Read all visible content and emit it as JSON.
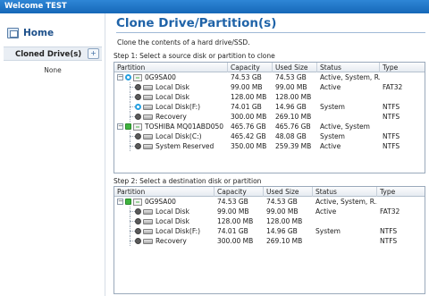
{
  "window": {
    "title": "Welcome TEST"
  },
  "sidebar": {
    "home_label": "Home",
    "cloned_label": "Cloned Drive(s)",
    "add_label": "+",
    "empty_text": "None"
  },
  "page": {
    "title": "Clone Drive/Partition(s)",
    "description": "Clone the contents of a hard drive/SSD."
  },
  "columns": [
    "Partition",
    "Capacity",
    "Used Size",
    "Status",
    "Type"
  ],
  "step1": {
    "title": "Step 1: Select a source disk or partition to clone",
    "rows": [
      {
        "kind": "disk",
        "expander": "−",
        "radio": "selected",
        "name": "0G9SA00",
        "capacity": "74.53 GB",
        "used": "74.53 GB",
        "status": "Active, System, R...",
        "type": ""
      },
      {
        "kind": "part",
        "radio": "gray",
        "name": "Local Disk",
        "capacity": "99.00 MB",
        "used": "99.00 MB",
        "status": "Active",
        "type": "FAT32"
      },
      {
        "kind": "part",
        "radio": "gray",
        "name": "Local Disk",
        "capacity": "128.00 MB",
        "used": "128.00 MB",
        "status": "",
        "type": ""
      },
      {
        "kind": "part",
        "radio": "selected",
        "name": "Local Disk(F:)",
        "capacity": "74.01 GB",
        "used": "14.96 GB",
        "status": "System",
        "type": "NTFS"
      },
      {
        "kind": "part",
        "radio": "gray",
        "name": "Recovery",
        "capacity": "300.00 MB",
        "used": "269.10 MB",
        "status": "",
        "type": "NTFS"
      },
      {
        "kind": "disk",
        "expander": "−",
        "radio": "green",
        "name": "TOSHIBA MQ01ABD050",
        "capacity": "465.76 GB",
        "used": "465.76 GB",
        "status": "Active, System",
        "type": ""
      },
      {
        "kind": "part",
        "radio": "gray",
        "name": "Local Disk(C:)",
        "capacity": "465.42 GB",
        "used": "48.08 GB",
        "status": "System",
        "type": "NTFS"
      },
      {
        "kind": "part",
        "radio": "gray",
        "name": "System Reserved",
        "capacity": "350.00 MB",
        "used": "259.39 MB",
        "status": "Active",
        "type": "NTFS"
      }
    ]
  },
  "step2": {
    "title": "Step 2: Select a destination disk or partition",
    "rows": [
      {
        "kind": "disk",
        "expander": "−",
        "radio": "green",
        "name": "0G9SA00",
        "capacity": "74.53 GB",
        "used": "74.53 GB",
        "status": "Active, System, R...",
        "type": ""
      },
      {
        "kind": "part",
        "radio": "gray",
        "name": "Local Disk",
        "capacity": "99.00 MB",
        "used": "99.00 MB",
        "status": "Active",
        "type": "FAT32"
      },
      {
        "kind": "part",
        "radio": "gray",
        "name": "Local Disk",
        "capacity": "128.00 MB",
        "used": "128.00 MB",
        "status": "",
        "type": ""
      },
      {
        "kind": "part",
        "radio": "gray",
        "name": "Local Disk(F:)",
        "capacity": "74.01 GB",
        "used": "14.96 GB",
        "status": "System",
        "type": "NTFS"
      },
      {
        "kind": "part",
        "radio": "gray",
        "name": "Recovery",
        "capacity": "300.00 MB",
        "used": "269.10 MB",
        "status": "",
        "type": "NTFS"
      }
    ]
  },
  "colors": {
    "title_blue": "#1f63a8",
    "titlebar": "#1668b8",
    "selected_radio": "#27a0e0",
    "disk_green": "#3fb33f"
  },
  "icons": {
    "home": "home-icon",
    "add": "add-icon",
    "disk": "drive-icon",
    "partition": "partition-icon"
  }
}
